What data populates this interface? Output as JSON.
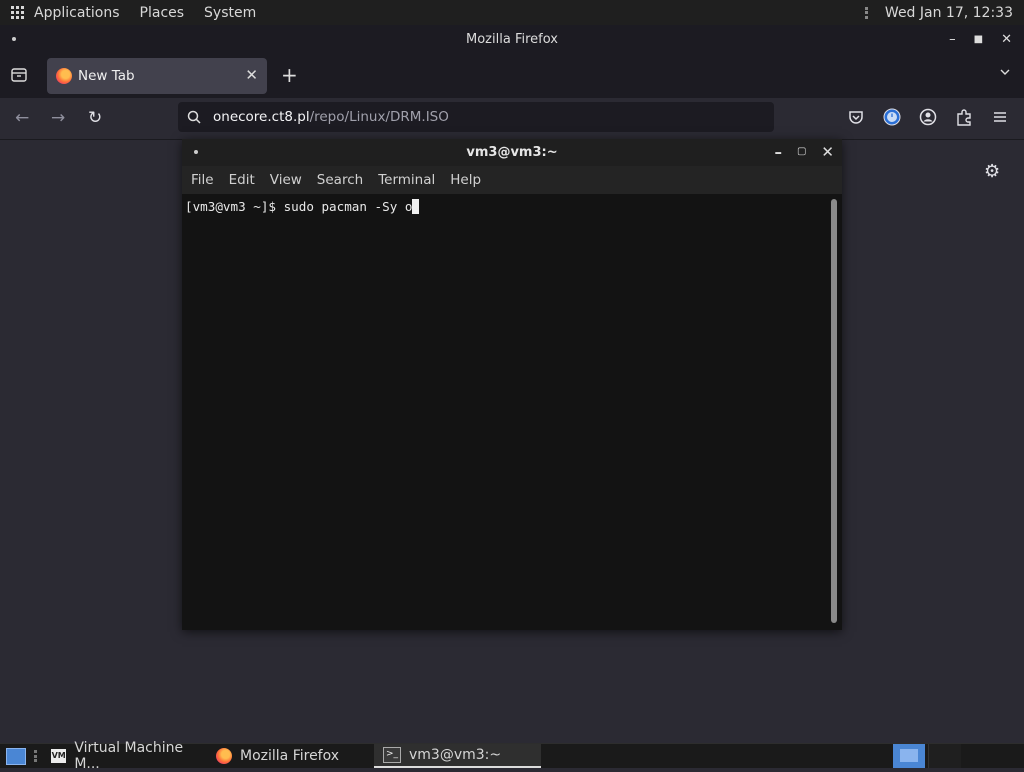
{
  "topbar": {
    "menus": [
      "Applications",
      "Places",
      "System"
    ],
    "clock": "Wed Jan 17, 12:33"
  },
  "firefox": {
    "window_title": "Mozilla Firefox",
    "tab_title": "New Tab",
    "url_host": "onecore.ct8.pl",
    "url_path": "/repo/Linux/DRM.ISO"
  },
  "terminal": {
    "title": "vm3@vm3:~",
    "menu": [
      "File",
      "Edit",
      "View",
      "Search",
      "Terminal",
      "Help"
    ],
    "command_line": "[vm3@vm3 ~]$ sudo pacman -Sy o"
  },
  "taskbar": {
    "tasks": [
      {
        "label": "Virtual Machine M...",
        "icon": "virt-manager-icon",
        "active": false
      },
      {
        "label": "Mozilla Firefox",
        "icon": "firefox-icon",
        "active": false
      },
      {
        "label": "vm3@vm3:~",
        "icon": "terminal-icon",
        "active": true
      }
    ]
  },
  "colors": {
    "firefox_bg": "#2b2a33",
    "terminal_bg": "#131313",
    "accent_blue": "#4a86d4"
  }
}
